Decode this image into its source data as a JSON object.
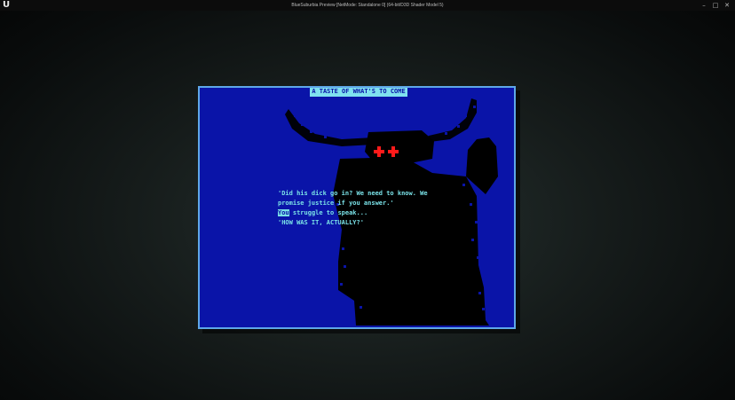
{
  "window": {
    "title": "BlueSuburbia Preview [NetMode: Standalone 0]  (64-bit/D3D Shader Model 5)",
    "logo": "U",
    "icons": {
      "minimize": "minimize-icon",
      "maximize": "maximize-icon",
      "close": "close-icon"
    }
  },
  "game": {
    "panel_title": "A TASTE OF WHAT'S TO COME",
    "dialog": {
      "line1": "'Did his dick go in? We need to know. We",
      "line2": "promise justice if you answer.'",
      "line3_highlight": "You",
      "line3_rest": " struggle to speak...",
      "line4": "'HOW WAS IT, ACTUALLY?'"
    },
    "colors": {
      "panel_bg": "#0a14a8",
      "panel_border": "#5ea7e8",
      "text": "#79e0e6",
      "creature": "#000000",
      "eyes": "#ff1a1a"
    }
  }
}
